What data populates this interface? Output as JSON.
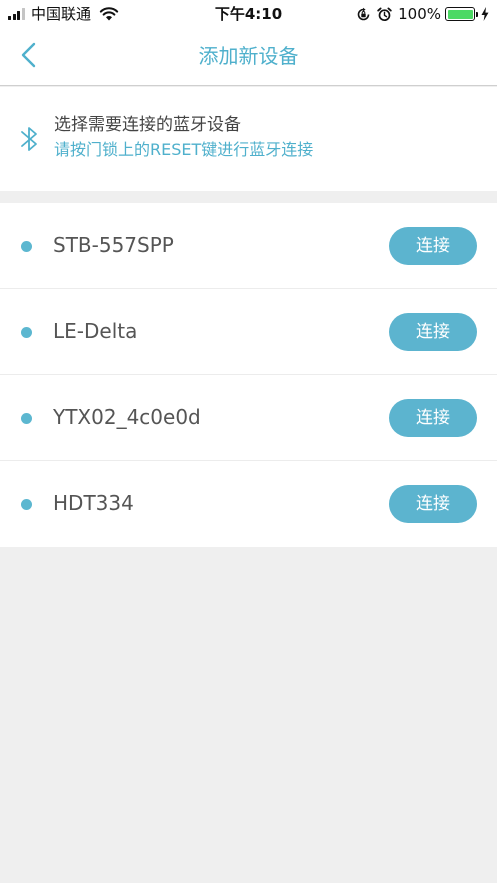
{
  "status_bar": {
    "carrier": "中国联通",
    "time": "下午4:10",
    "battery_percent": "100%",
    "battery_level": 1.0,
    "battery_color": "#4cd964"
  },
  "nav": {
    "title": "添加新设备",
    "back_icon": "chevron-left-icon"
  },
  "hint": {
    "icon": "bluetooth-icon",
    "line1": "选择需要连接的蓝牙设备",
    "line2": "请按门锁上的RESET键进行蓝牙连接"
  },
  "devices": [
    {
      "name": "STB-557SPP",
      "button": "连接"
    },
    {
      "name": "LE-Delta",
      "button": "连接"
    },
    {
      "name": "YTX02_4c0e0d",
      "button": "连接"
    },
    {
      "name": "HDT334",
      "button": "连接"
    }
  ],
  "colors": {
    "accent": "#4fb0cc",
    "button": "#5cb4cf",
    "background": "#efefef"
  }
}
